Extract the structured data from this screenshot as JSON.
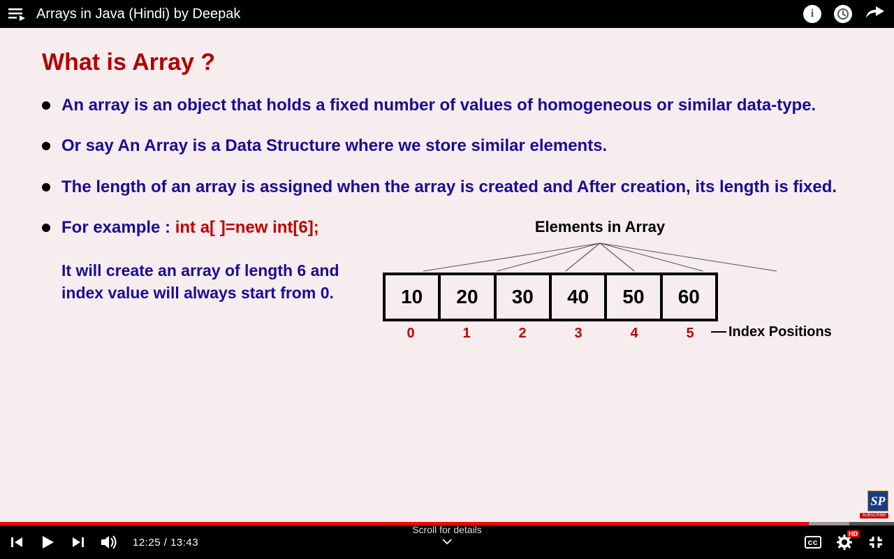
{
  "topbar": {
    "title": "Arrays in Java (Hindi) by Deepak"
  },
  "slide": {
    "heading": "What is Array ?",
    "bullets": [
      "An array is an object that holds a fixed number of values of homogeneous or similar data-type.",
      "Or say An Array is a Data Structure where we store similar elements.",
      "The length of an array is assigned when the array is created and After creation, its length is fixed."
    ],
    "example_label": "For example : ",
    "example_code": "int a[ ]=new int[6];",
    "example_desc": "It will create an array of length 6 and index value will always start from 0.",
    "diagram_title": "Elements in Array",
    "cells": [
      "10",
      "20",
      "30",
      "40",
      "50",
      "60"
    ],
    "indices": [
      "0",
      "1",
      "2",
      "3",
      "4",
      "5"
    ],
    "index_label": "Index Positions"
  },
  "logo": {
    "text": "SP",
    "subscribe": "SUBSCRIBE"
  },
  "player": {
    "current": "12:25",
    "duration": "13:43",
    "played_pct": 90.5,
    "buffered_pct": 95,
    "scroll_hint": "Scroll for details",
    "cc": "cc",
    "hd": "HD"
  }
}
